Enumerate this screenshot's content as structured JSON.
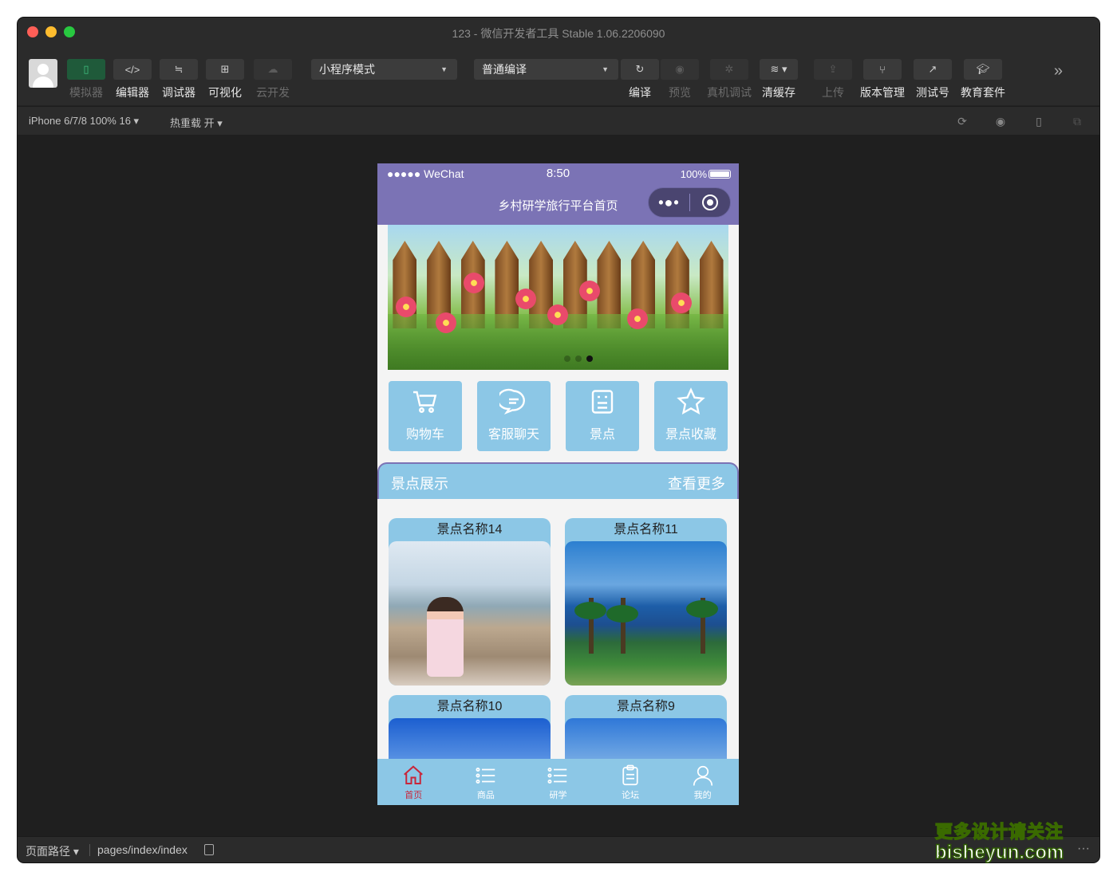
{
  "window": {
    "title": "123 - 微信开发者工具 Stable 1.06.2206090"
  },
  "toolbar": {
    "buttons": [
      {
        "label": "模拟器",
        "icon": "phone-icon"
      },
      {
        "label": "编辑器",
        "icon": "code-icon"
      },
      {
        "label": "调试器",
        "icon": "debug-icon"
      },
      {
        "label": "可视化",
        "icon": "layout-icon"
      },
      {
        "label": "云开发",
        "icon": "cloud-icon"
      }
    ],
    "mode_select": "小程序模式",
    "compile_select": "普通编译",
    "actions": [
      {
        "label": "编译",
        "icon": "refresh-icon"
      },
      {
        "label": "预览",
        "icon": "eye-icon"
      },
      {
        "label": "真机调试",
        "icon": "bug-icon"
      },
      {
        "label": "清缓存",
        "icon": "layers-icon"
      },
      {
        "label": "上传",
        "icon": "upload-icon"
      },
      {
        "label": "版本管理",
        "icon": "branch-icon"
      },
      {
        "label": "测试号",
        "icon": "external-icon"
      },
      {
        "label": "教育套件",
        "icon": "graduation-icon"
      }
    ]
  },
  "subbar": {
    "device": "iPhone 6/7/8 100% 16",
    "hot_reload": "热重载 开"
  },
  "phone": {
    "status": {
      "carrier": "●●●●● WeChat",
      "time": "8:50",
      "battery": "100%"
    },
    "nav_title": "乡村研学旅行平台首页",
    "menu": [
      {
        "label": "购物车",
        "icon": "cart-icon"
      },
      {
        "label": "客服聊天",
        "icon": "chat-icon"
      },
      {
        "label": "景点",
        "icon": "list-icon"
      },
      {
        "label": "景点收藏",
        "icon": "star-icon"
      }
    ],
    "section": {
      "title": "景点展示",
      "more": "查看更多"
    },
    "cards": [
      {
        "title": "景点名称14"
      },
      {
        "title": "景点名称11"
      },
      {
        "title": "景点名称10"
      },
      {
        "title": "景点名称9"
      }
    ],
    "tabs": [
      {
        "label": "首页",
        "icon": "home-icon"
      },
      {
        "label": "商品",
        "icon": "list-icon"
      },
      {
        "label": "研学",
        "icon": "list-icon"
      },
      {
        "label": "论坛",
        "icon": "clipboard-icon"
      },
      {
        "label": "我的",
        "icon": "user-icon"
      }
    ]
  },
  "footer": {
    "label": "页面路径",
    "path": "pages/index/index"
  },
  "watermark": {
    "line1": "更多设计请关注",
    "line2": "bisheyun.com"
  }
}
